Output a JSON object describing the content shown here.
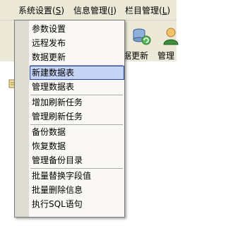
{
  "menubar": {
    "items": [
      {
        "label": "系统设置(",
        "accel": "S",
        "close": ")"
      },
      {
        "label": "信息管理(",
        "accel": "I",
        "close": ")"
      },
      {
        "label": "栏目管理(",
        "accel": "L",
        "close": ")"
      }
    ]
  },
  "toolbar": {
    "buttons": [
      {
        "label": "据更新",
        "icon": "database-refresh-icon"
      },
      {
        "label": "管理",
        "icon": "user-admin-icon"
      }
    ]
  },
  "dropdown": {
    "items": [
      {
        "label": "参数设置"
      },
      {
        "label": "远程发布"
      },
      {
        "label": "数据更新"
      },
      {
        "label": "新建数据表",
        "selected": true
      },
      {
        "label": "管理数据表"
      },
      {
        "label": "增加刷新任务"
      },
      {
        "label": "管理刷新任务"
      },
      {
        "label": "备份数据"
      },
      {
        "label": "恢复数据"
      },
      {
        "label": "管理备份目录"
      },
      {
        "label": "批量替换字段值"
      },
      {
        "label": "批量删除信息"
      },
      {
        "label": "执行SQL语句"
      }
    ]
  },
  "colors": {
    "selection_bg": "#c5d3f5",
    "selection_border": "#2b3fa8",
    "menubar_bg": "#ece9d8"
  }
}
